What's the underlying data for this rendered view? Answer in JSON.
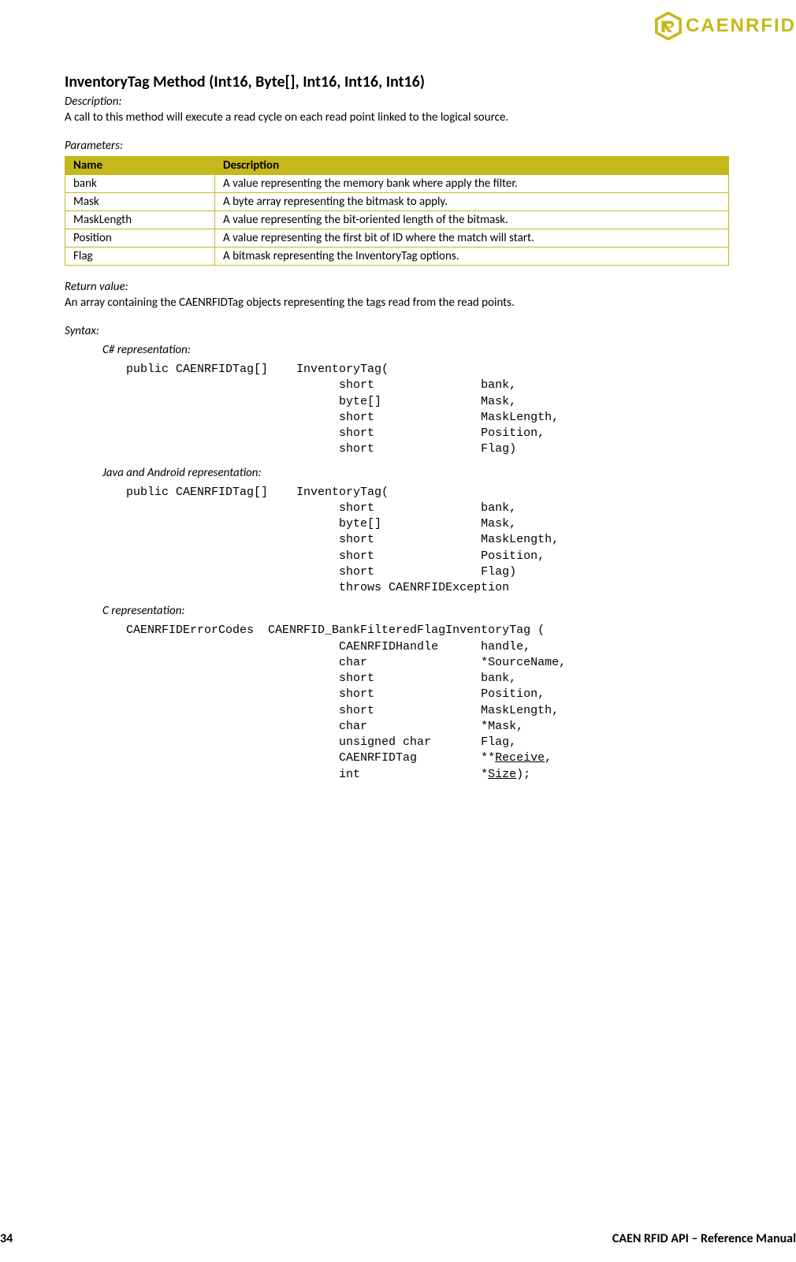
{
  "logo": {
    "text": "CAENRFID"
  },
  "title": "InventoryTag Method (Int16, Byte[], Int16, Int16, Int16)",
  "description_label": "Description:",
  "description_text": "A call to this method will execute a read cycle on each read point linked to the logical source.",
  "parameters_label": "Parameters:",
  "params_table": {
    "head": {
      "name": "Name",
      "desc": "Description"
    },
    "rows": [
      {
        "name": "bank",
        "desc": "A value representing the memory bank where apply the filter."
      },
      {
        "name": "Mask",
        "desc": "A byte array representing the bitmask to apply."
      },
      {
        "name": "MaskLength",
        "desc": "A value representing the bit-oriented length of the bitmask."
      },
      {
        "name": "Position",
        "desc": "A value representing the first bit of ID where the match will start."
      },
      {
        "name": "Flag",
        "desc": "A bitmask representing the InventoryTag options."
      }
    ]
  },
  "return_label": "Return value:",
  "return_text": "An array containing the CAENRFIDTag objects representing the tags read from the read points.",
  "syntax_label": "Syntax:",
  "csharp_label": "C# representation:",
  "csharp_code": "public CAENRFIDTag[]    InventoryTag(\n                              short               bank,\n                              byte[]              Mask,\n                              short               MaskLength,\n                              short               Position,\n                              short               Flag)",
  "java_label": "Java and Android representation:",
  "java_code": "public CAENRFIDTag[]    InventoryTag(\n                              short               bank,\n                              byte[]              Mask,\n                              short               MaskLength,\n                              short               Position,\n                              short               Flag)\n                              throws CAENRFIDException",
  "c_label": "C representation:",
  "c_code_prefix": "CAENRFIDErrorCodes  CAENRFID_BankFilteredFlagInventoryTag (\n                              CAENRFIDHandle      handle,\n                              char                *SourceName,\n                              short               bank,\n                              short               Position,\n                              short               MaskLength,\n                              char                *Mask,\n                              unsigned char       Flag,\n                              CAENRFIDTag         **",
  "c_code_receive": "Receive",
  "c_code_mid": ",\n                              int                 *",
  "c_code_size": "Size",
  "c_code_suffix": ");",
  "footer": {
    "page": "34",
    "title": "CAEN RFID API – Reference Manual"
  }
}
